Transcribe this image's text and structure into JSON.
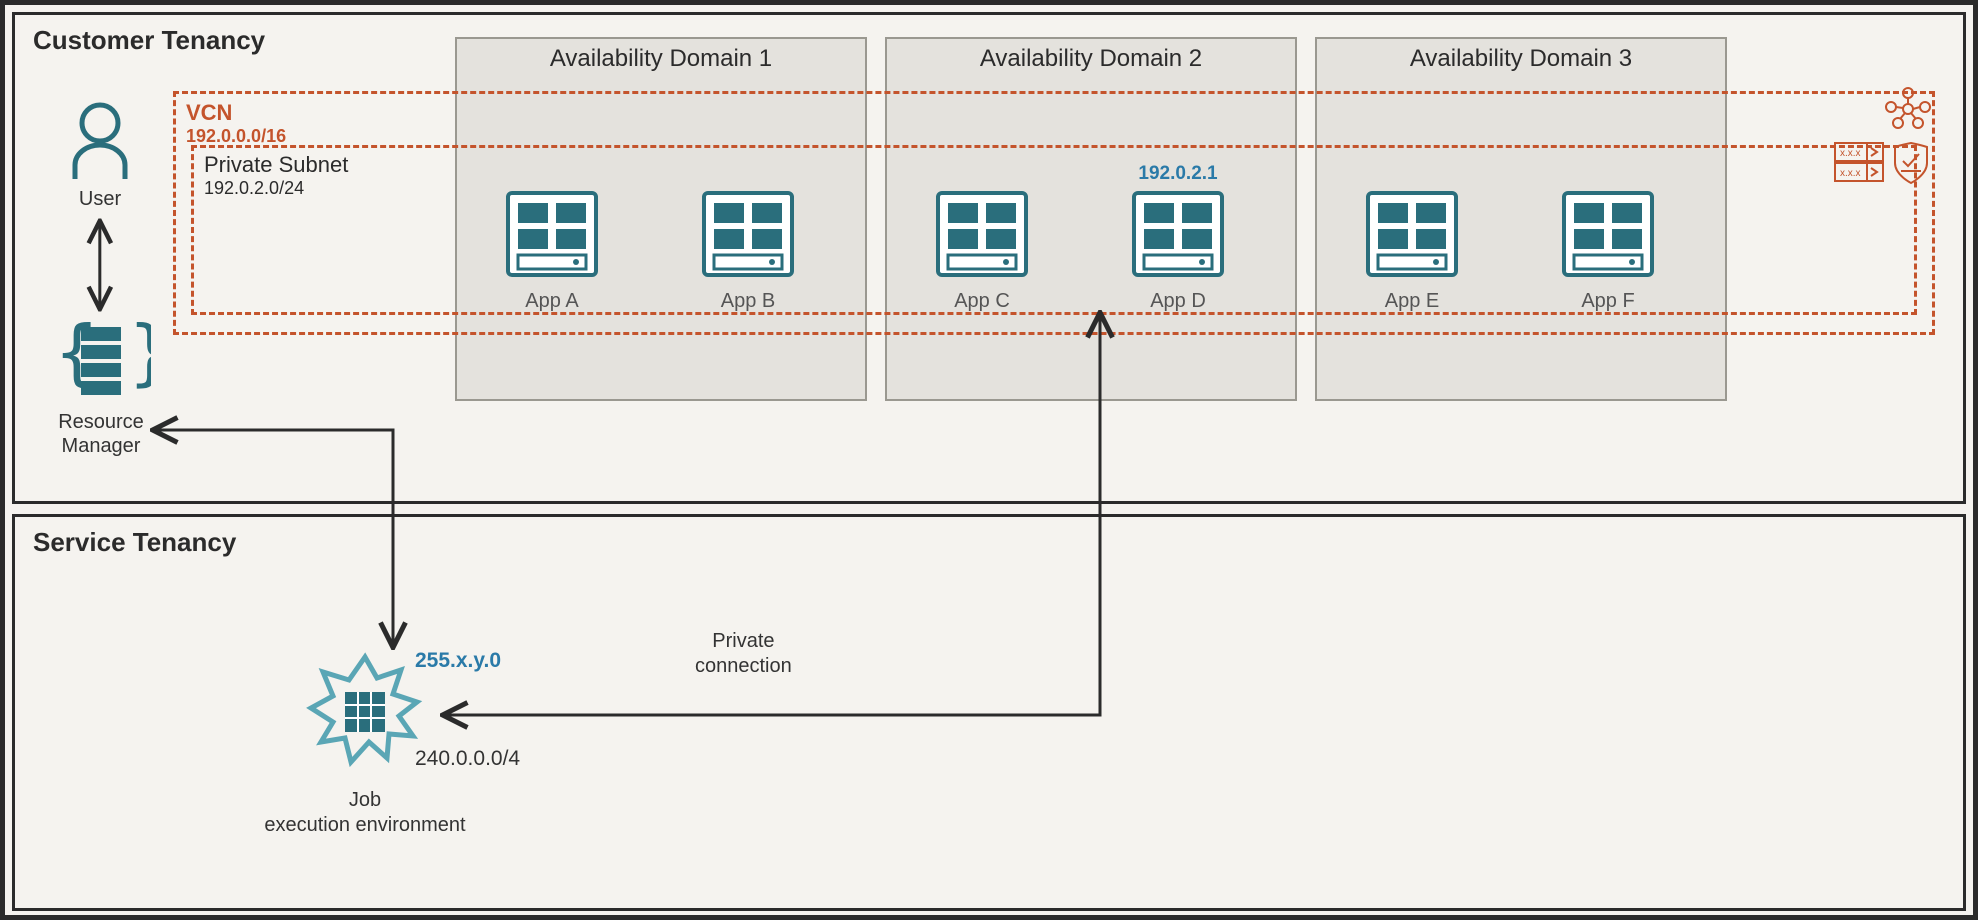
{
  "customer_tenancy": {
    "title": "Customer Tenancy"
  },
  "service_tenancy": {
    "title": "Service Tenancy"
  },
  "vcn": {
    "label": "VCN",
    "cidr": "192.0.0.0/16"
  },
  "subnet": {
    "label": "Private Subnet",
    "cidr": "192.0.2.0/24"
  },
  "availability_domains": [
    {
      "title": "Availability Domain 1"
    },
    {
      "title": "Availability Domain 2"
    },
    {
      "title": "Availability Domain 3"
    }
  ],
  "apps": {
    "a": {
      "label": "App A"
    },
    "b": {
      "label": "App B"
    },
    "c": {
      "label": "App C"
    },
    "d": {
      "label": "App D",
      "ip": "192.0.2.1"
    },
    "e": {
      "label": "App E"
    },
    "f": {
      "label": "App F"
    }
  },
  "user": {
    "label": "User"
  },
  "resource_manager": {
    "label": "Resource\nManager"
  },
  "job": {
    "label": "Job\nexecution environment",
    "ip_blue": "255.x.y.0",
    "ip_gray": "240.0.0.0/4"
  },
  "connection": {
    "label": "Private\nconnection"
  },
  "icons": {
    "topology": "network-topology-icon",
    "route_table": "route-table-icon",
    "shield": "security-list-icon"
  }
}
